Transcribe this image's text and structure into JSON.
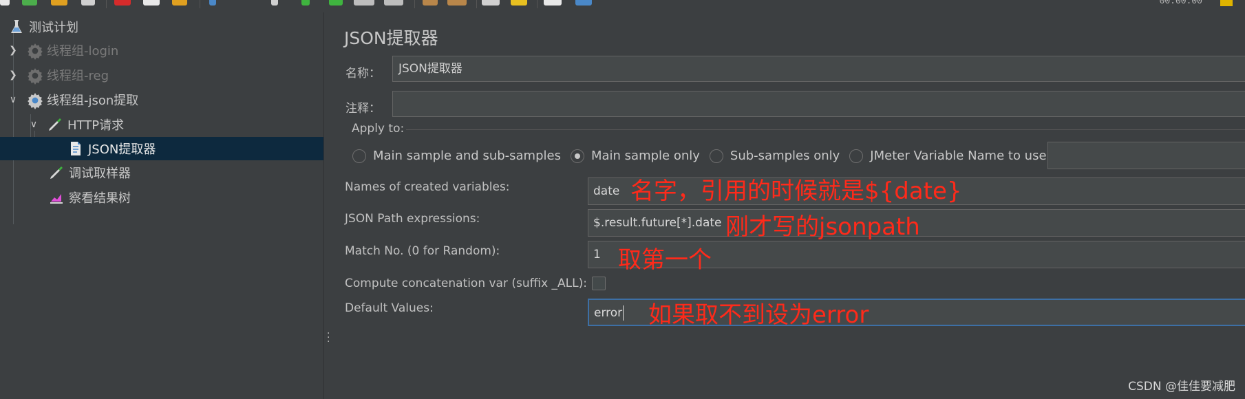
{
  "toolbar": {
    "readout": "00:00:00",
    "icons": [
      "new-icon",
      "templates-icon",
      "open-icon",
      "save-icon",
      "cut-icon",
      "copy-icon",
      "paste-icon",
      "expand-icon",
      "toggle-icon",
      "start-icon",
      "start-no-pauses-icon",
      "stop-icon",
      "shutdown-icon",
      "clear-icon",
      "clear-all-icon",
      "search-icon",
      "reset-search-icon",
      "function-helper-icon",
      "help-icon",
      "warning-icon"
    ]
  },
  "tree": {
    "items": [
      {
        "label": "测试计划",
        "icon": "flask-icon",
        "state": "normal"
      },
      {
        "label": "线程组-login",
        "icon": "gear-icon",
        "state": "disabled"
      },
      {
        "label": "线程组-reg",
        "icon": "gear-icon",
        "state": "disabled"
      },
      {
        "label": "线程组-json提取",
        "icon": "gear-icon",
        "state": "expanded"
      },
      {
        "label": "HTTP请求",
        "icon": "pipette-icon",
        "state": "expanded"
      },
      {
        "label": "JSON提取器",
        "icon": "document-icon",
        "state": "selected"
      },
      {
        "label": "调试取样器",
        "icon": "pipette-icon",
        "state": "normal"
      },
      {
        "label": "察看结果树",
        "icon": "chart-icon",
        "state": "normal"
      }
    ]
  },
  "panel": {
    "title": "JSON提取器",
    "name_label": "名称：",
    "name_value": "JSON提取器",
    "comment_label": "注释：",
    "comment_value": "",
    "apply_to_label": "Apply to:",
    "apply_options": [
      {
        "label": "Main sample and sub-samples",
        "selected": false
      },
      {
        "label": "Main sample only",
        "selected": true
      },
      {
        "label": "Sub-samples only",
        "selected": false
      },
      {
        "label": "JMeter Variable Name to use",
        "selected": false
      }
    ],
    "jmeter_var_value": "",
    "names_label": "Names of created variables:",
    "names_value": "date",
    "json_path_label": "JSON Path expressions:",
    "json_path_value": "$.result.future[*].date",
    "match_label": "Match No. (0 for Random):",
    "match_value": "1",
    "concat_label": "Compute concatenation var (suffix _ALL):",
    "concat_checked": false,
    "default_label": "Default Values:",
    "default_value": "error"
  },
  "annotations": {
    "names_note": "名字，引用的时候就是${date}",
    "json_path_note": "刚才写的jsonpath",
    "match_note": "取第一个",
    "default_note": "如果取不到设为error"
  },
  "watermark": "CSDN @佳佳要减肥",
  "colors": {
    "background": "#3c3f41",
    "selected_row": "#0d293e",
    "field_bg": "#45494a",
    "annotation": "#ff2a1a",
    "focus_border": "#3d6fa5"
  }
}
